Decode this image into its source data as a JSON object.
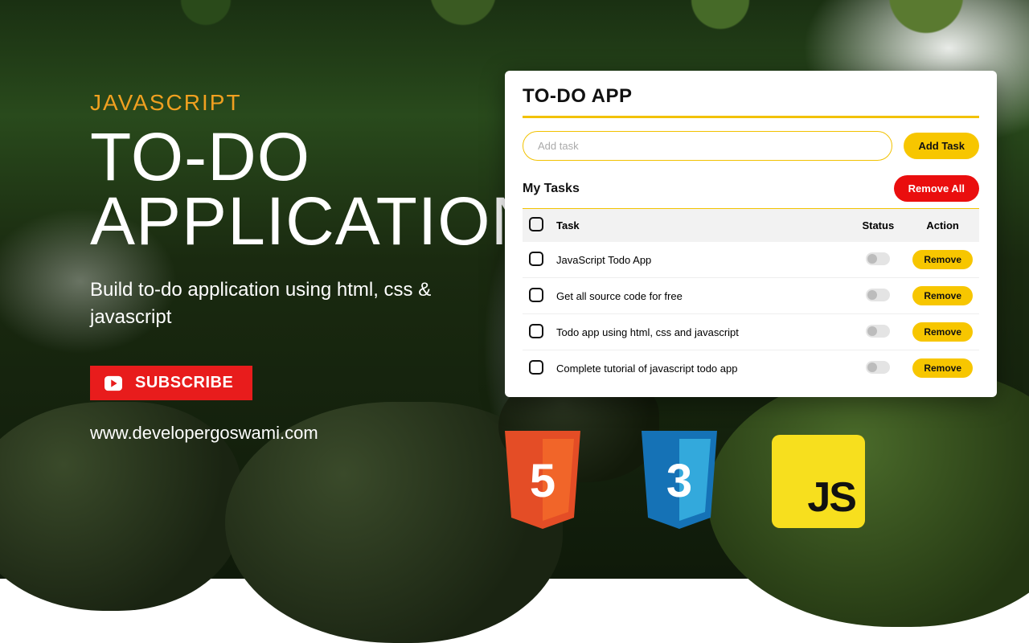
{
  "kicker": "JAVASCRIPT",
  "title_line1": "TO-DO",
  "title_line2": "APPLICATION",
  "subtitle": "Build to-do application using html, css & javascript",
  "subscribe_label": "SUBSCRIBE",
  "website_url": "www.developergoswami.com",
  "app": {
    "title": "TO-DO APP",
    "input_placeholder": "Add task",
    "add_button": "Add Task",
    "section_heading": "My Tasks",
    "remove_all_button": "Remove All",
    "columns": {
      "task": "Task",
      "status": "Status",
      "action": "Action"
    },
    "remove_label": "Remove",
    "tasks": [
      {
        "text": "JavaScript Todo App"
      },
      {
        "text": "Get all source code for free"
      },
      {
        "text": "Todo app using html, css and javascript"
      },
      {
        "text": "Complete tutorial of javascript todo app"
      }
    ]
  },
  "logos": {
    "html5_glyph": "5",
    "css3_glyph": "3",
    "js_glyph": "JS"
  }
}
